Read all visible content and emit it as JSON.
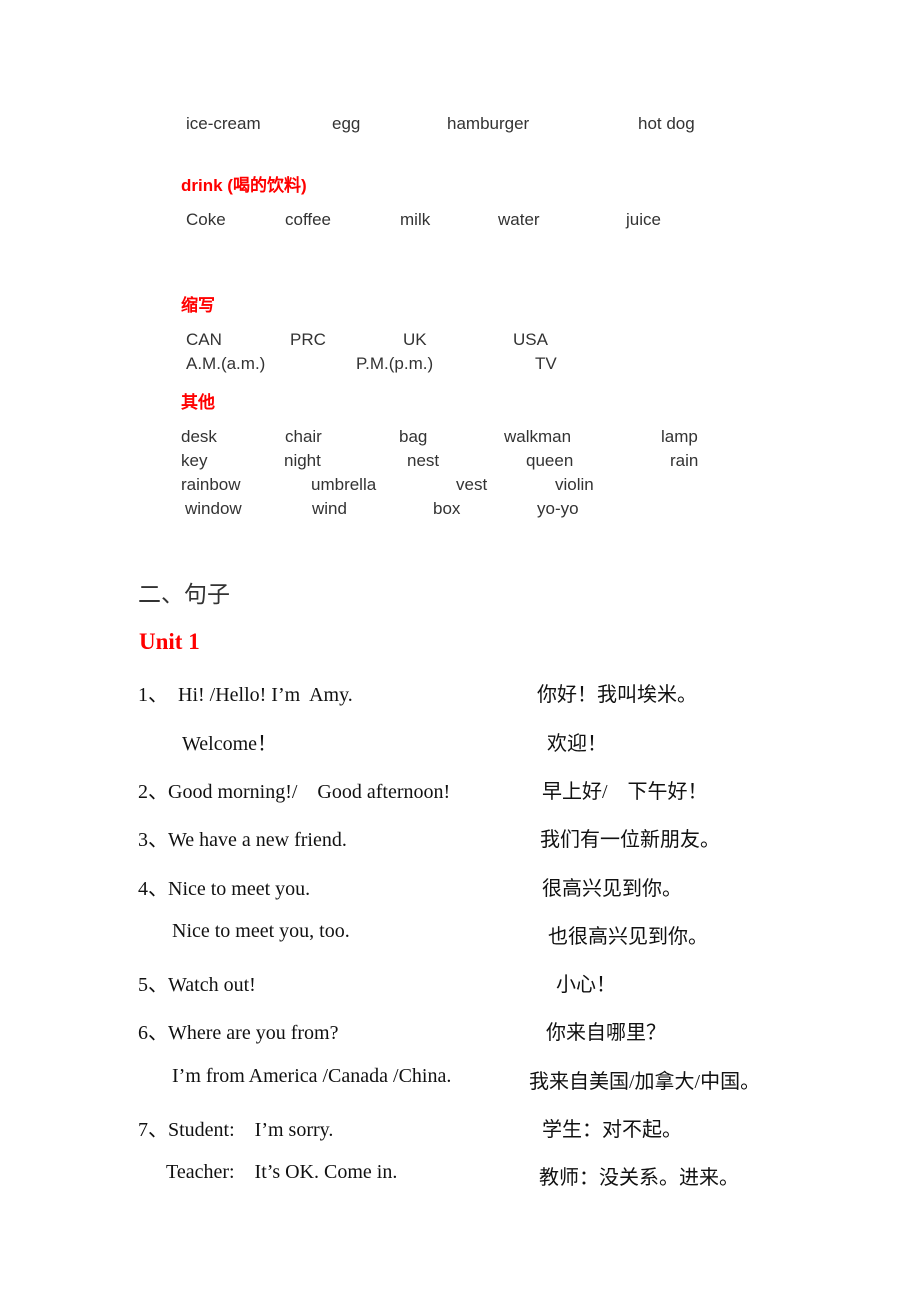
{
  "food_row": [
    "ice-cream",
    "egg",
    "hamburger",
    "hot dog"
  ],
  "drink": {
    "heading": "drink  (喝的饮料)",
    "items": [
      "Coke",
      "coffee",
      "milk",
      "water",
      "juice"
    ]
  },
  "abbreviations": {
    "heading": "缩写",
    "row1": [
      "CAN",
      "PRC",
      "UK",
      "USA"
    ],
    "row2": [
      "A.M.(a.m.)",
      "P.M.(p.m.)",
      "TV"
    ]
  },
  "others": {
    "heading": "其他",
    "rows": [
      [
        "desk",
        "chair",
        "bag",
        "walkman",
        "lamp"
      ],
      [
        "key",
        "night",
        "nest",
        "queen",
        "rain"
      ],
      [
        "rainbow",
        "umbrella",
        "vest",
        "violin"
      ],
      [
        "window",
        "wind",
        "box",
        "yo-yo"
      ]
    ]
  },
  "sentences": {
    "section_title": "二、句子",
    "unit_title": "Unit 1",
    "lines": [
      {
        "en": "1、  Hi! /Hello! I’m  Amy.",
        "zh": "你好！我叫埃米。"
      },
      {
        "en": "Welcome！",
        "zh": "欢迎！"
      },
      {
        "en": "2、Good morning!/    Good afternoon!",
        "zh": "早上好/    下午好！"
      },
      {
        "en": "3、We have a new friend.",
        "zh": "我们有一位新朋友。"
      },
      {
        "en": "4、Nice to meet you.",
        "zh": "很高兴见到你。"
      },
      {
        "en": "Nice to meet you, too.",
        "zh": "也很高兴见到你。"
      },
      {
        "en": "5、Watch out!",
        "zh": "小心！"
      },
      {
        "en": "6、Where are you from?",
        "zh": "你来自哪里？"
      },
      {
        "en": "I’m from America /Canada /China.",
        "zh": "我来自美国/加拿大/中国。"
      },
      {
        "en": "7、Student:    I’m sorry.",
        "zh": "学生：对不起。"
      },
      {
        "en": "Teacher:    It’s OK. Come in.",
        "zh": "教师：没关系。进来。"
      }
    ]
  }
}
